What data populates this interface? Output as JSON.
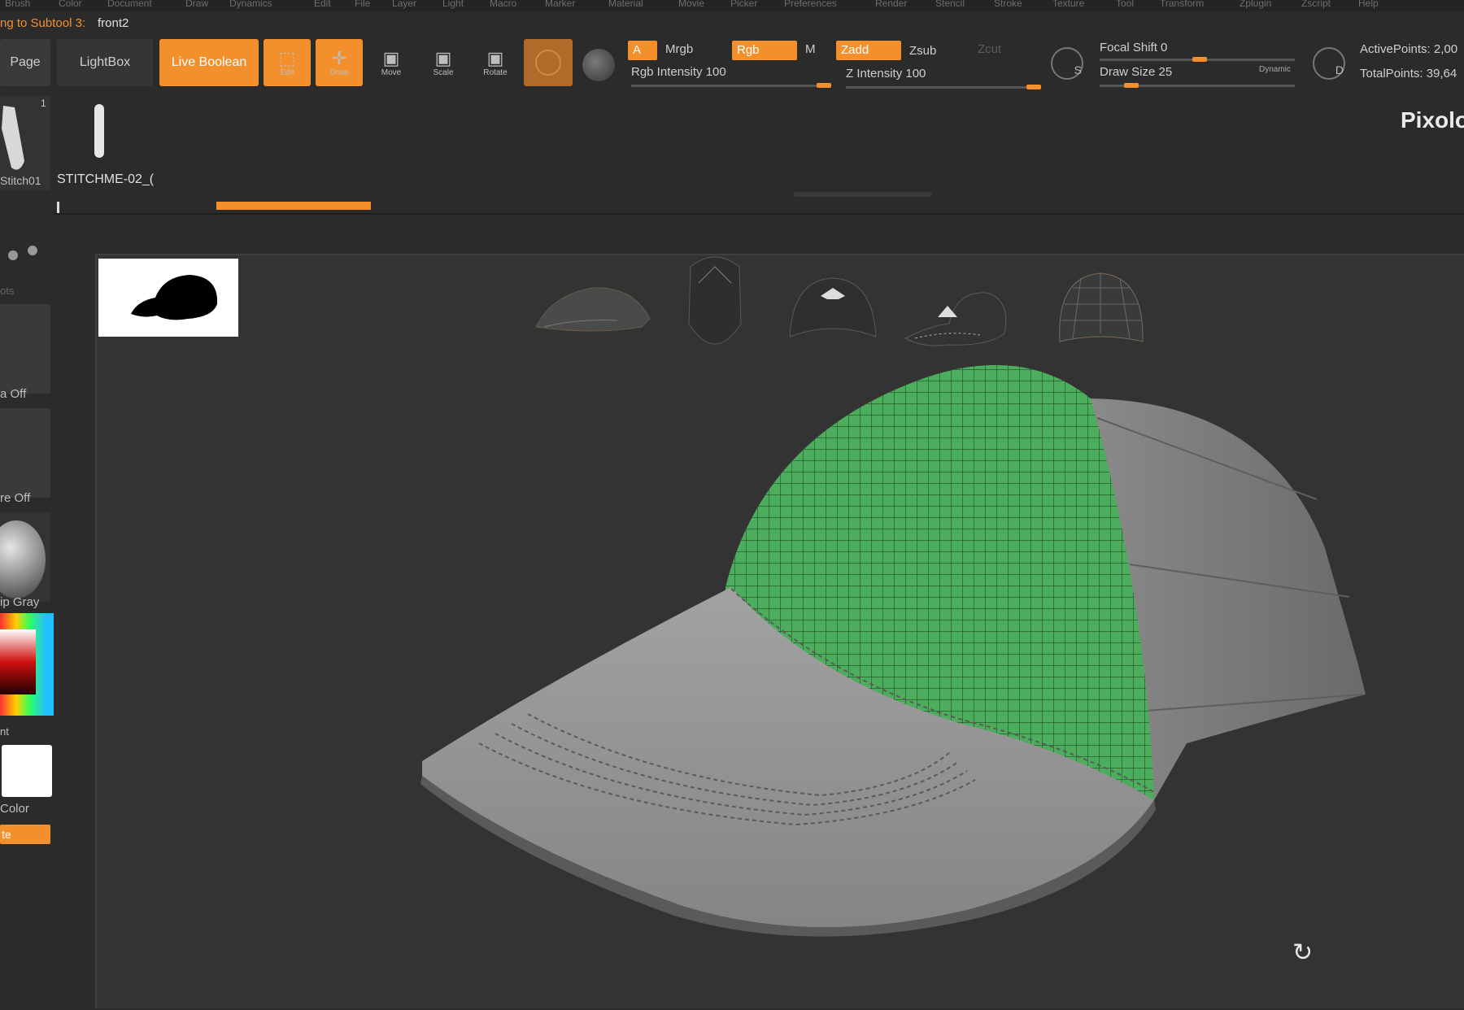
{
  "menu": [
    "Brush",
    "Color",
    "Document",
    "Draw",
    "Dynamics",
    "Edit",
    "File",
    "Layer",
    "Light",
    "Macro",
    "Marker",
    "Material",
    "Movie",
    "Picker",
    "Preferences",
    "Render",
    "Stencil",
    "Stroke",
    "Texture",
    "Tool",
    "Transform",
    "Zplugin",
    "Zscript",
    "Help"
  ],
  "title": {
    "prefix": "ng to Subtool 3:",
    "name": "front2"
  },
  "toolbar": {
    "page": "Page",
    "lightbox": "LightBox",
    "live_boolean": "Live Boolean",
    "edit": "Edit",
    "draw": "Draw",
    "move": "Move",
    "scale": "Scale",
    "rotate": "Rotate",
    "a": "A",
    "mrgb": "Mrgb",
    "rgb": "Rgb",
    "m": "M",
    "zadd": "Zadd",
    "zsub": "Zsub",
    "zcut": "Zcut",
    "rgb_intensity": "Rgb Intensity 100",
    "z_intensity": "Z Intensity 100",
    "focal_shift": "Focal Shift 0",
    "draw_size": "Draw Size 25",
    "dynamic": "Dynamic",
    "active_points": "ActivePoints: 2,00",
    "total_points": "TotalPoints: 39,64"
  },
  "left_tray": {
    "count": "1",
    "brush_name": "Stitch01",
    "dots": "ots",
    "a_off": "a Off",
    "re_off": "re Off",
    "material": "ip Gray",
    "nt": "nt",
    "color": "Color",
    "te": "te"
  },
  "subtool": {
    "name": "STITCHME-02_("
  },
  "brand": "Pixolo",
  "thumbnails": [
    "cap-side-view",
    "cap-back-view",
    "cap-front-view",
    "cap-three-quarter-view",
    "cap-wireframe-view"
  ],
  "colors": {
    "accent": "#f4902c",
    "mesh_green": "#4cae5c",
    "bg": "#2b2b2b",
    "viewport": "#333333"
  }
}
